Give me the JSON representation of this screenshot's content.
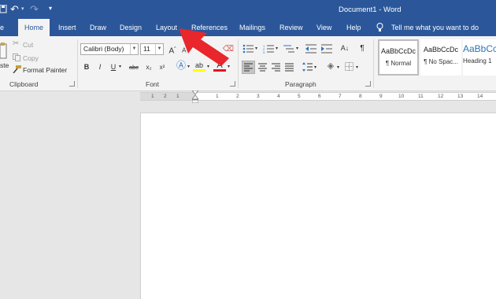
{
  "titlebar": {
    "title": "Document1  -  Word",
    "qat_icons": [
      "save-icon",
      "undo-icon",
      "redo-icon",
      "customize-qat-icon"
    ],
    "bg": "#2b579a"
  },
  "tabs": {
    "file": "e",
    "home": "Home",
    "insert": "Insert",
    "draw": "Draw",
    "design": "Design",
    "layout": "Layout",
    "references": "References",
    "mailings": "Mailings",
    "review": "Review",
    "view": "View",
    "help": "Help",
    "tell_me": "Tell me what you want to do"
  },
  "clipboard": {
    "paste": "ste",
    "cut": "Cut",
    "copy": "Copy",
    "format_painter": "Format Painter",
    "group": "Clipboard"
  },
  "font": {
    "family": "Calibri (Body)",
    "size": "11",
    "bold": "B",
    "italic": "I",
    "underline": "U",
    "strike": "abc",
    "subscript": "x₂",
    "superscript": "x²",
    "grow": "A",
    "shrink": "A",
    "group": "Font"
  },
  "paragraph": {
    "group": "Paragraph",
    "pilcrow": "¶"
  },
  "styles": [
    {
      "preview": "AaBbCcDc",
      "name": "¶ Normal"
    },
    {
      "preview": "AaBbCcDc",
      "name": "¶ No Spac..."
    },
    {
      "preview": "AaBbCc",
      "name": "Heading 1"
    }
  ],
  "ruler": {
    "ticks": [
      "1",
      "2",
      "1",
      "1",
      "2",
      "3",
      "4",
      "5",
      "6",
      "7",
      "8",
      "9",
      "10",
      "11",
      "12",
      "13",
      "14"
    ]
  },
  "colors": {
    "accent": "#2b579a",
    "annotation_arrow": "#e8262b",
    "highlight": "#ffff00",
    "font_color": "#e81123"
  }
}
